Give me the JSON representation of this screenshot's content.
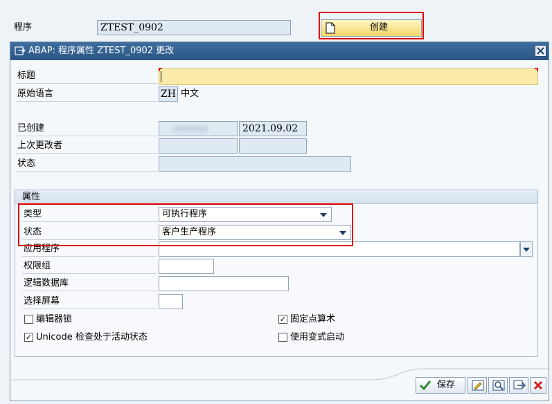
{
  "top": {
    "program_label": "程序",
    "program_value": "ZTEST_0902",
    "create_button": "创建"
  },
  "dialog": {
    "title": "ABAP: 程序属性 ZTEST_0902 更改",
    "title_label": "标题",
    "title_value": "",
    "orig_lang_label": "原始语言",
    "orig_lang_code": "ZH",
    "orig_lang_name": "中文",
    "created_label": "已创建",
    "created_by": "",
    "created_date": "2021.09.02",
    "last_changed_label": "上次更改者",
    "last_changed_by": "",
    "last_changed_date": "",
    "status_label": "状态",
    "status_value": ""
  },
  "attributes": {
    "group_title": "属性",
    "type_label": "类型",
    "type_value": "可执行程序",
    "status_label": "状态",
    "status_value": "客户生产程序",
    "app_label": "应用程序",
    "app_value": "",
    "auth_group_label": "权限组",
    "auth_group_value": "",
    "logical_db_label": "逻辑数据库",
    "logical_db_value": "",
    "selection_screen_label": "选择屏幕",
    "selection_screen_value": "",
    "editor_lock_label": "编辑器锁",
    "editor_lock_checked": false,
    "fixed_point_label": "固定点算术",
    "fixed_point_checked": true,
    "unicode_label": "Unicode 检查处于活动状态",
    "unicode_checked": true,
    "variant_start_label": "使用变式启动",
    "variant_start_checked": false
  },
  "footer": {
    "save_label": "保存"
  },
  "colors": {
    "titlebar": "#2a5585",
    "highlight": "#e00000",
    "required_field": "#fbeba8"
  }
}
